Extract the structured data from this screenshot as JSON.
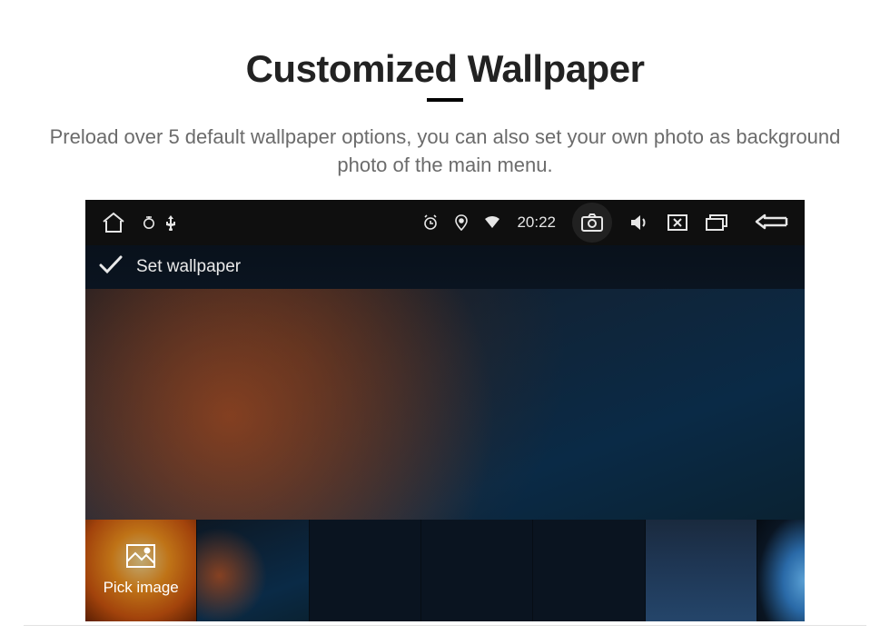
{
  "page": {
    "title": "Customized Wallpaper",
    "subtitle": "Preload over 5 default wallpaper options, you can also set your own photo as background photo of the main menu."
  },
  "status_bar": {
    "time": "20:22"
  },
  "title_bar": {
    "label": "Set wallpaper"
  },
  "thumbnails": {
    "pick_label": "Pick image"
  }
}
